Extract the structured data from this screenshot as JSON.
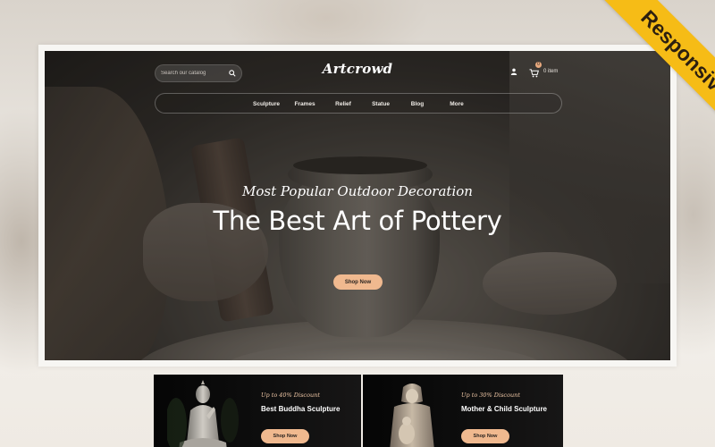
{
  "header": {
    "search_placeholder": "Search our catalog",
    "logo": "Artcrowd",
    "cart_count": "0",
    "cart_label": "0 item"
  },
  "nav": {
    "items": [
      {
        "label": "Sculpture"
      },
      {
        "label": "Frames"
      },
      {
        "label": "Relief"
      },
      {
        "label": "Statue"
      },
      {
        "label": "Blog"
      },
      {
        "label": "More"
      }
    ]
  },
  "hero": {
    "subtitle": "Most Popular Outdoor Decoration",
    "title": "The Best Art of Pottery",
    "button": "Shop Now"
  },
  "ribbon": {
    "label": "Responsive"
  },
  "banners": [
    {
      "discount": "Up to 40% Discount",
      "title": "Best Buddha Sculpture",
      "button": "Shop Now"
    },
    {
      "discount": "Up to 30% Discount",
      "title": "Mother & Child Sculpture",
      "button": "Shop Now"
    }
  ],
  "colors": {
    "accent": "#f0b98f",
    "ribbon": "#f6bc16"
  },
  "icons": {
    "search": "search-icon",
    "user": "user-icon",
    "cart": "cart-icon"
  }
}
